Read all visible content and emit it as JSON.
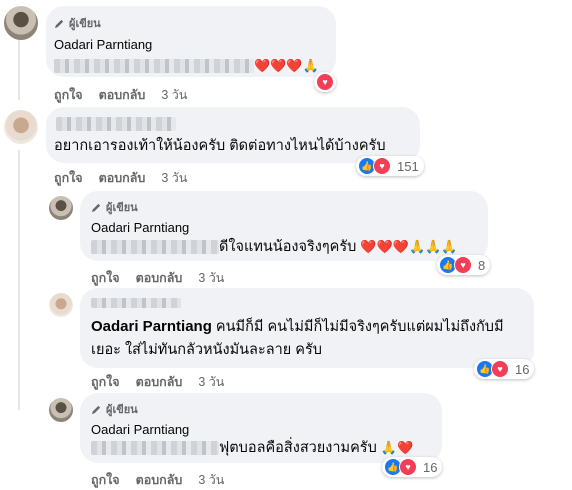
{
  "author_badge_label": "ผู้เขียน",
  "actions": {
    "like": "ถูกใจ",
    "reply": "ตอบกลับ"
  },
  "comments": [
    {
      "author_badge": true,
      "name": "Oadari Parntiang",
      "text": "",
      "emoji": "❤️❤️❤️🙏",
      "time": "3 วัน",
      "reactions": [
        "love"
      ],
      "reaction_count": ""
    },
    {
      "author_badge": false,
      "name": "",
      "text": "อยากเอารองเท้าให้น้องครับ ติดต่อทางไหนได้บ้างครับ",
      "emoji": "",
      "time": "3 วัน",
      "reactions": [
        "like",
        "love"
      ],
      "reaction_count": "151"
    },
    {
      "author_badge": true,
      "name": "Oadari Parntiang",
      "text": "ดีใจแทนน้องจริงๆครับ",
      "emoji": "❤️❤️❤️🙏🙏🙏",
      "time": "3 วัน",
      "reactions": [
        "like",
        "love"
      ],
      "reaction_count": "8"
    },
    {
      "author_badge": false,
      "name": "Oadari Parntiang",
      "text_line1": "คนมีก็มี คนไม่มีก็ไม่มีจริงๆครับแต่ผมไม่ถึงกับมี",
      "text_line2": "เยอะ ใส่ไม่ทันกลัวหนังมันละลาย ครับ",
      "time": "3 วัน",
      "reactions": [
        "like",
        "love"
      ],
      "reaction_count": "16"
    },
    {
      "author_badge": true,
      "name": "Oadari Parntiang",
      "text": "ฟุตบอลคือสิ่งสวยงามครับ",
      "emoji": "🙏❤️",
      "time": "3 วัน",
      "reactions": [
        "like",
        "love"
      ],
      "reaction_count": "16"
    }
  ]
}
